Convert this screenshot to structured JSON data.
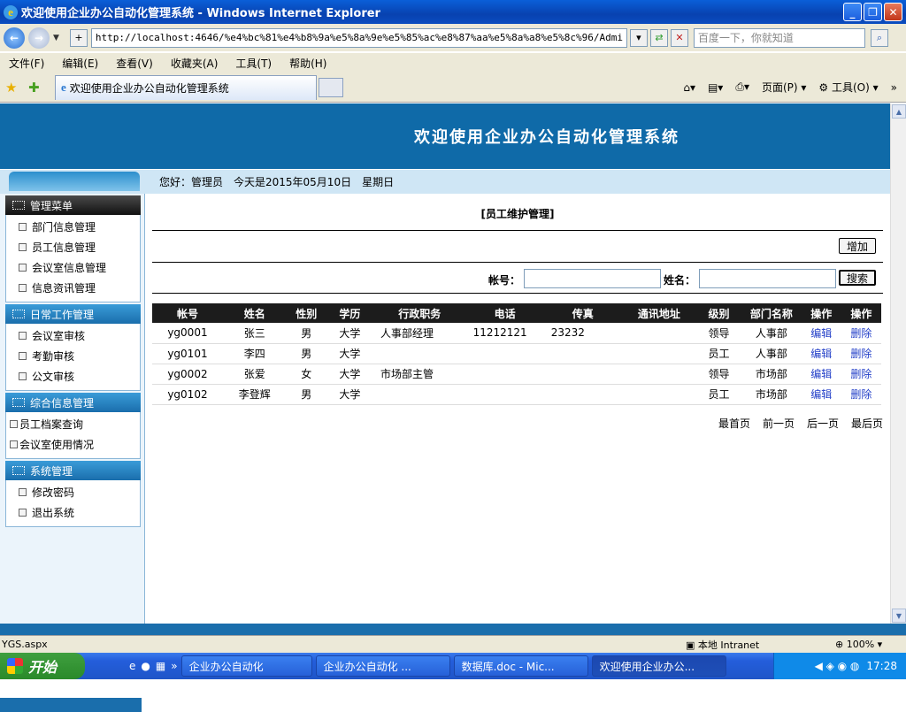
{
  "window": {
    "title": "欢迎使用企业办公自动化管理系统 - Windows Internet Explorer"
  },
  "address": {
    "url": "http://localhost:4646/%e4%bc%81%e4%b8%9a%e5%8a%9e%e5%85%ac%e8%87%aa%e5%8a%a8%e5%8c%96/Admi",
    "search_placeholder": "百度一下，你就知道"
  },
  "menu": [
    "文件(F)",
    "编辑(E)",
    "查看(V)",
    "收藏夹(A)",
    "工具(T)",
    "帮助(H)"
  ],
  "tab": {
    "title": "欢迎使用企业办公自动化管理系统"
  },
  "toolbar": {
    "page": "页面(P)",
    "tools": "工具(O)"
  },
  "site": {
    "title": "欢迎使用企业办公自动化管理系统",
    "greeting": "您好：管理员　今天是2015年05月10日　星期日"
  },
  "sidebar": {
    "groups": [
      {
        "title": "管理菜单",
        "items": [
          "部门信息管理",
          "员工信息管理",
          "会议室信息管理",
          "信息资讯管理"
        ]
      },
      {
        "title": "日常工作管理",
        "items": [
          "会议室审核",
          "考勤审核",
          "公文审核"
        ]
      },
      {
        "title": "综合信息管理",
        "items": [
          "员工档案查询",
          "会议室使用情况"
        ]
      },
      {
        "title": "系统管理",
        "items": [
          "修改密码",
          "退出系统"
        ]
      }
    ]
  },
  "main": {
    "title": "[员工维护管理]",
    "add_label": "增加",
    "account_label": "帐号：",
    "name_label": "姓名：",
    "search_label": "搜索",
    "columns": [
      "帐号",
      "姓名",
      "性别",
      "学历",
      "行政职务",
      "电话",
      "传真",
      "通讯地址",
      "级别",
      "部门名称",
      "操作",
      "操作"
    ],
    "rows": [
      [
        "yg0001",
        "张三",
        "男",
        "大学",
        "人事部经理",
        "11212121",
        "23232",
        "",
        "领导",
        "人事部",
        "编辑",
        "删除"
      ],
      [
        "yg0101",
        "李四",
        "男",
        "大学",
        "",
        "",
        "",
        "",
        "员工",
        "人事部",
        "编辑",
        "删除"
      ],
      [
        "yg0002",
        "张爱",
        "女",
        "大学",
        "市场部主管",
        "",
        "",
        "",
        "领导",
        "市场部",
        "编辑",
        "删除"
      ],
      [
        "yg0102",
        "李登辉",
        "男",
        "大学",
        "",
        "",
        "",
        "",
        "员工",
        "市场部",
        "编辑",
        "删除"
      ]
    ],
    "pager": [
      "最首页",
      "前一页",
      "后一页",
      "最后页"
    ]
  },
  "statusbar": {
    "file": "YGS.aspx",
    "zone": "本地 Intranet",
    "zoom": "100%"
  },
  "taskbar": {
    "start": "开始",
    "tasks": [
      "企业办公自动化",
      "企业办公自动化 ...",
      "数据库.doc - Mic...",
      "欢迎使用企业办公..."
    ],
    "clock": "17:28"
  }
}
